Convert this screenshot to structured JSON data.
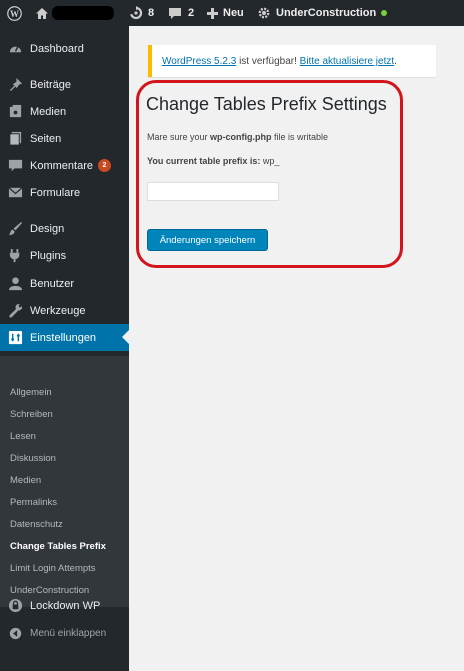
{
  "admin_bar": {
    "updates_count": "8",
    "comments_count": "2",
    "new_label": "Neu",
    "site_name": "UnderConstruction",
    "site_status_color": "#7ad03a"
  },
  "sidebar": {
    "items": [
      {
        "label": "Dashboard",
        "icon": "dashboard-icon"
      },
      {
        "label": "Beiträge",
        "icon": "pin-icon"
      },
      {
        "label": "Medien",
        "icon": "media-icon"
      },
      {
        "label": "Seiten",
        "icon": "pages-icon"
      },
      {
        "label": "Kommentare",
        "icon": "comments-icon",
        "badge": "2"
      },
      {
        "label": "Formulare",
        "icon": "mail-icon"
      },
      {
        "label": "Design",
        "icon": "brush-icon"
      },
      {
        "label": "Plugins",
        "icon": "plugin-icon"
      },
      {
        "label": "Benutzer",
        "icon": "user-icon"
      },
      {
        "label": "Werkzeuge",
        "icon": "wrench-icon"
      },
      {
        "label": "Einstellungen",
        "icon": "settings-icon",
        "active": true
      }
    ],
    "submenu": [
      "Allgemein",
      "Schreiben",
      "Lesen",
      "Diskussion",
      "Medien",
      "Permalinks",
      "Datenschutz",
      "Change Tables Prefix",
      "Limit Login Attempts",
      "UnderConstruction"
    ],
    "submenu_current": "Change Tables Prefix",
    "lockdown_label": "Lockdown WP",
    "collapse_label": "Menü einklappen"
  },
  "notice": {
    "version_link": "WordPress 5.2.3",
    "middle_text": " ist verfügbar! ",
    "update_link": "Bitte aktualisiere jetzt",
    "end_text": "."
  },
  "settings": {
    "title": "Change Tables Prefix Settings",
    "writable_prefix": "Mare sure your ",
    "writable_file": "wp-config.php",
    "writable_suffix": " file is writable",
    "current_prefix_label": "You current table prefix is: ",
    "current_prefix_value": "wp_",
    "new_prefix_value": "",
    "save_label": "Änderungen speichern"
  },
  "colors": {
    "admin_dark": "#23282d",
    "submenu_bg": "#32373c",
    "accent": "#0073aa",
    "button": "#0085ba",
    "notice_border": "#ffb900",
    "badge": "#ca4a1f",
    "highlight": "#d2151c"
  }
}
